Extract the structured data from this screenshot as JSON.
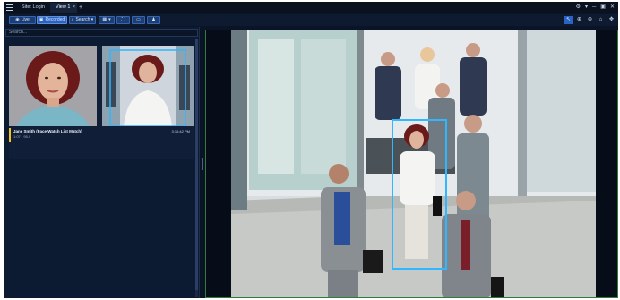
{
  "titlebar": {
    "tabs": [
      {
        "label": "Site: Login"
      },
      {
        "label": "View 1"
      }
    ],
    "tab_close": "×",
    "add_tab": "+",
    "right_icons": [
      "⚙",
      "▾",
      "─",
      "▣",
      "✕"
    ]
  },
  "toolbar": {
    "live_label": "Live",
    "recorded_label": "Recorded",
    "search_label": "Search",
    "search_caret": "▾",
    "layout_caret": "▾",
    "right_tools": [
      "↖",
      "⊕",
      "⊖",
      "⌂",
      "✥"
    ]
  },
  "left_panel": {
    "search_placeholder": "Search...",
    "result": {
      "title": "Jane Smith (Face Watch List Match)",
      "subtitle": "1:07 • 95.0",
      "time": "3:16:42 PM"
    }
  },
  "colors": {
    "background": "#0b1426",
    "accent_blue": "#2a63c4",
    "detection_box": "#2fb7ff",
    "match_indicator": "#f2c418",
    "tile_border": "#2f7d3a"
  }
}
